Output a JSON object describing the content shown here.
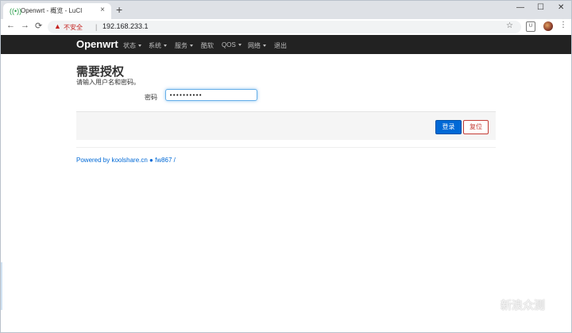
{
  "browser": {
    "tab_title": "Openwrt - 概览 - LuCI",
    "tab_close": "×",
    "new_tab": "+",
    "win_minimize": "—",
    "win_maximize": "☐",
    "win_close": "✕",
    "back": "←",
    "forward": "→",
    "reload": "⟳",
    "insecure_label": "不安全",
    "separator": "|",
    "url": "192.168.233.1",
    "star": "☆",
    "ext_icon": "U",
    "menu": "⋮"
  },
  "navbar": {
    "brand": "Openwrt",
    "items": [
      {
        "label": "状态",
        "dropdown": true
      },
      {
        "label": "系统",
        "dropdown": true
      },
      {
        "label": "服务",
        "dropdown": true
      },
      {
        "label": "酷软",
        "dropdown": false
      },
      {
        "label": "QOS",
        "dropdown": true
      },
      {
        "label": "网络",
        "dropdown": true
      },
      {
        "label": "退出",
        "dropdown": false
      }
    ]
  },
  "login": {
    "title": "需要授权",
    "description": "请输入用户名和密码。",
    "password_label": "密码",
    "password_value": "••••••••••",
    "login_button": "登录",
    "reset_button": "复位"
  },
  "footer": {
    "text": "Powered by koolshare.cn ● fw867 /"
  },
  "watermark": "新浪众测"
}
